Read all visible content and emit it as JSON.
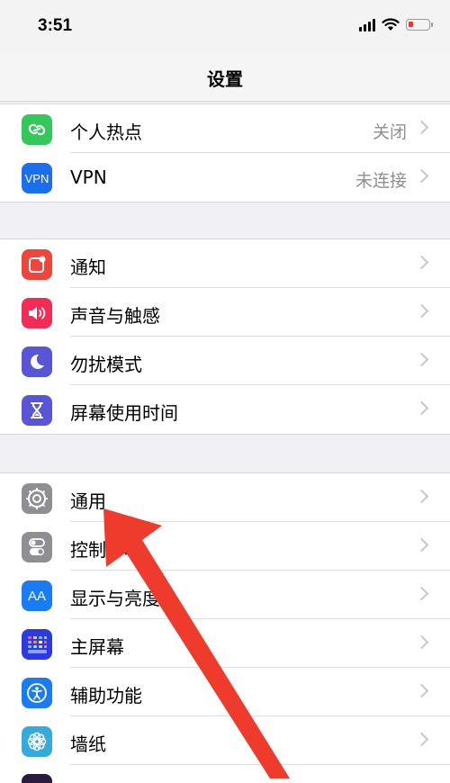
{
  "status": {
    "time": "3:51"
  },
  "nav": {
    "title": "设置"
  },
  "groups": [
    {
      "items": [
        {
          "label": "个人热点",
          "value": "关闭",
          "icon": "hotspot-icon",
          "color": "#34c759"
        },
        {
          "label": "VPN",
          "value": "未连接",
          "icon": "vpn-icon",
          "icon_text": "VPN",
          "color": "#1a6ff0"
        }
      ]
    },
    {
      "items": [
        {
          "label": "通知",
          "icon": "notifications-icon",
          "color": "#f0453a"
        },
        {
          "label": "声音与触感",
          "icon": "sound-icon",
          "color": "#f22c54"
        },
        {
          "label": "勿扰模式",
          "icon": "moon-icon",
          "color": "#5856d6"
        },
        {
          "label": "屏幕使用时间",
          "icon": "hourglass-icon",
          "color": "#5856d6"
        }
      ]
    },
    {
      "items": [
        {
          "label": "通用",
          "icon": "gear-icon",
          "color": "#8e8e93"
        },
        {
          "label": "控制中心",
          "icon": "toggles-icon",
          "color": "#8e8e93"
        },
        {
          "label": "显示与亮度",
          "icon": "display-icon",
          "icon_text": "AA",
          "color": "#1a7cf5"
        },
        {
          "label": "主屏幕",
          "icon": "home-screen-icon",
          "color": "#2d3ae0"
        },
        {
          "label": "辅助功能",
          "icon": "accessibility-icon",
          "color": "#1a7cf5"
        },
        {
          "label": "墙纸",
          "icon": "wallpaper-icon",
          "color": "#36aadc"
        }
      ]
    }
  ],
  "annotation": {
    "arrow_color": "#ee3b2c"
  }
}
